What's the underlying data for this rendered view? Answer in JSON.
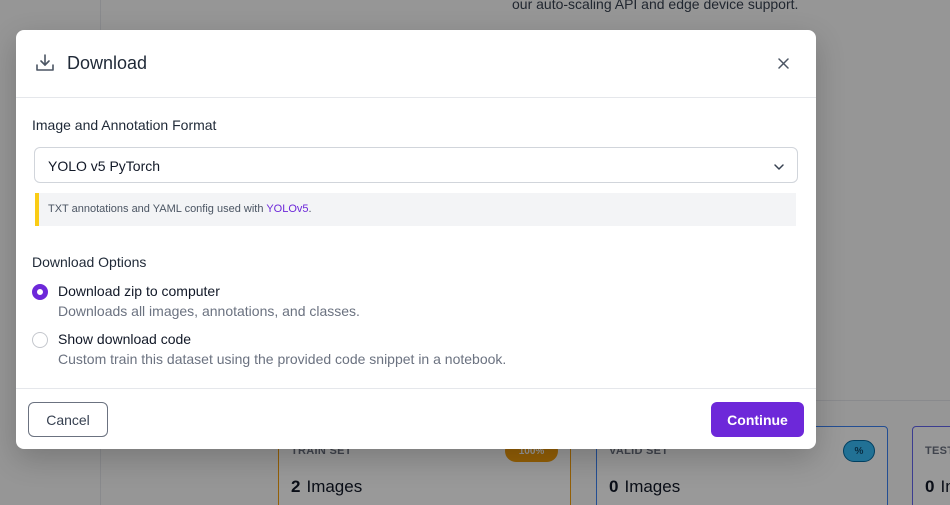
{
  "background": {
    "top_text": "our auto-scaling API and edge device support.",
    "cards": {
      "train": {
        "title": "TRAIN SET",
        "badge": "100%",
        "count": "2",
        "unit": "Images"
      },
      "valid": {
        "title": "VALID SET",
        "badge": "%",
        "count": "0",
        "unit": "Images"
      },
      "test": {
        "title": "TEST",
        "count": "0",
        "unit": "Ima"
      }
    }
  },
  "modal": {
    "title": "Download",
    "icon": "download-icon",
    "close_icon": "close-icon",
    "format": {
      "label": "Image and Annotation Format",
      "selected": "YOLO v5 PyTorch",
      "info_text": "TXT annotations and YAML config used with ",
      "info_link": "YOLOv5",
      "info_suffix": "."
    },
    "options": {
      "label": "Download Options",
      "items": [
        {
          "title": "Download zip to computer",
          "description": "Downloads all images, annotations, and classes.",
          "selected": true
        },
        {
          "title": "Show download code",
          "description": "Custom train this dataset using the provided code snippet in a notebook.",
          "selected": false
        }
      ]
    },
    "footer": {
      "cancel_label": "Cancel",
      "continue_label": "Continue"
    }
  },
  "colors": {
    "accent": "#6d28d9",
    "info_border": "#facc15",
    "train_border": "#f59e0b",
    "valid_border": "#3b82f6"
  }
}
